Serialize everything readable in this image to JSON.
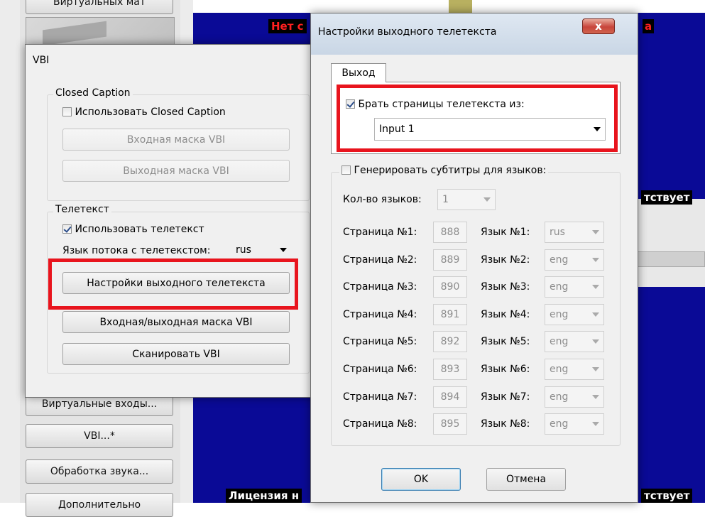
{
  "background": {
    "buttons": {
      "top": "Виртуальных мат",
      "virtual_inputs": "Виртуальные входы...",
      "vbi": "VBI...*",
      "sound": "Обработка звука...",
      "bottom": "Дополнительно"
    },
    "overlay_top_left": "Нет с",
    "overlay_top_right": "а",
    "overlay_mid_right": "тствует",
    "overlay_bottom_left": "Лицензия н",
    "overlay_bottom_right": "тствует"
  },
  "vbi_dialog": {
    "title": "VBI",
    "closed_caption": {
      "legend": "Closed Caption",
      "use_label": "Использовать Closed Caption",
      "use_checked": false,
      "input_mask": "Входная маска VBI",
      "output_mask": "Выходная маска VBI"
    },
    "teletext": {
      "legend": "Телетекст",
      "use_label": "Использовать телетекст",
      "use_checked": true,
      "stream_lang_label": "Язык потока с телетекстом:",
      "stream_lang_value": "rus",
      "output_settings": "Настройки выходного телетекста",
      "io_mask": "Входная/выходная маска VBI",
      "scan": "Сканировать VBI"
    }
  },
  "teletext_dialog": {
    "title": "Настройки выходного телетекста",
    "close_glyph": "x",
    "tab": "Выход",
    "take_pages_label": "Брать страницы телетекста из:",
    "take_pages_checked": true,
    "source_value": "Input 1",
    "subtitles_label": "Генерировать субтитры для языков:",
    "subtitles_checked": false,
    "lang_count_label": "Кол-во языков:",
    "lang_count_value": "1",
    "rows": [
      {
        "page_label": "Страница №1:",
        "page": "888",
        "lang_label": "Язык №1:",
        "lang": "rus"
      },
      {
        "page_label": "Страница №2:",
        "page": "889",
        "lang_label": "Язык №2:",
        "lang": "eng"
      },
      {
        "page_label": "Страница №3:",
        "page": "890",
        "lang_label": "Язык №3:",
        "lang": "eng"
      },
      {
        "page_label": "Страница №4:",
        "page": "891",
        "lang_label": "Язык №4:",
        "lang": "eng"
      },
      {
        "page_label": "Страница №5:",
        "page": "892",
        "lang_label": "Язык №5:",
        "lang": "eng"
      },
      {
        "page_label": "Страница №6:",
        "page": "893",
        "lang_label": "Язык №6:",
        "lang": "eng"
      },
      {
        "page_label": "Страница №7:",
        "page": "894",
        "lang_label": "Язык №7:",
        "lang": "eng"
      },
      {
        "page_label": "Страница №8:",
        "page": "895",
        "lang_label": "Язык №8:",
        "lang": "eng"
      }
    ],
    "ok": "OK",
    "cancel": "Отмена"
  },
  "colors": {
    "highlight": "#e8141d",
    "video_blue": "#0a0a96"
  }
}
